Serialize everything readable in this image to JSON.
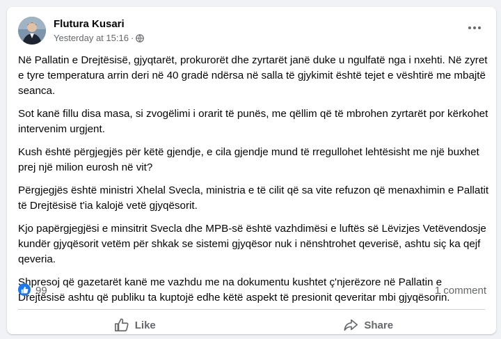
{
  "post": {
    "author": "Flutura Kusari",
    "timestamp": "Yesterday at 15:16",
    "separator": "·",
    "privacy_icon": "globe-icon",
    "paragraphs": [
      "Në Pallatin e Drejtësisë, gjyqtarët, prokurorët dhe zyrtarët janë duke u ngulfatë nga i nxehti. Në zyret e tyre temperatura arrin deri në 40 gradë ndërsa në salla të gjykimit është tejet e vështirë me mbajtë seanca.",
      "Sot kanë fillu disa masa, si zvogëlimi i orarit të punës, me qëllim që të mbrohen zyrtarët por kërkohet intervenim urgjent.",
      "Kush është përgjegjës për këtë gjendje, e cila gjendje mund të rregullohet lehtësisht me një buxhet prej një milion eurosh në vit?",
      "Përgjegjës është ministri Xhelal Svecla, ministria e të cilit që sa vite refuzon që menaxhimin e Pallatit të Drejtësisë t'ia kalojë vetë gjyqësorit.",
      "Kjo papërgjegjësi e minsitrit Svecla dhe MPB-së është vazhdimësi e luftës së Lëvizjes Vetëvendosje kundër gjyqësorit vetëm për shkak se sistemi gjyqësor nuk i nënshtrohet qeverisë, ashtu siç ka qejf qeveria.",
      "Shpresoj që gazetarët kanë me vazhdu me na dokumentu kushtet ç'njerëzore në Pallatin e Drejtësisë ashtu që publiku ta kuptojë edhe këtë aspekt të presionit qeveritar mbi gjyqësorin."
    ]
  },
  "reactions": {
    "count": "99",
    "icon": "like-reaction-icon",
    "comments": "1 comment"
  },
  "actions": {
    "like_label": "Like",
    "share_label": "Share"
  },
  "colors": {
    "accent": "#1877f2",
    "secondary_text": "#65676b",
    "background": "#f0f2f5"
  }
}
